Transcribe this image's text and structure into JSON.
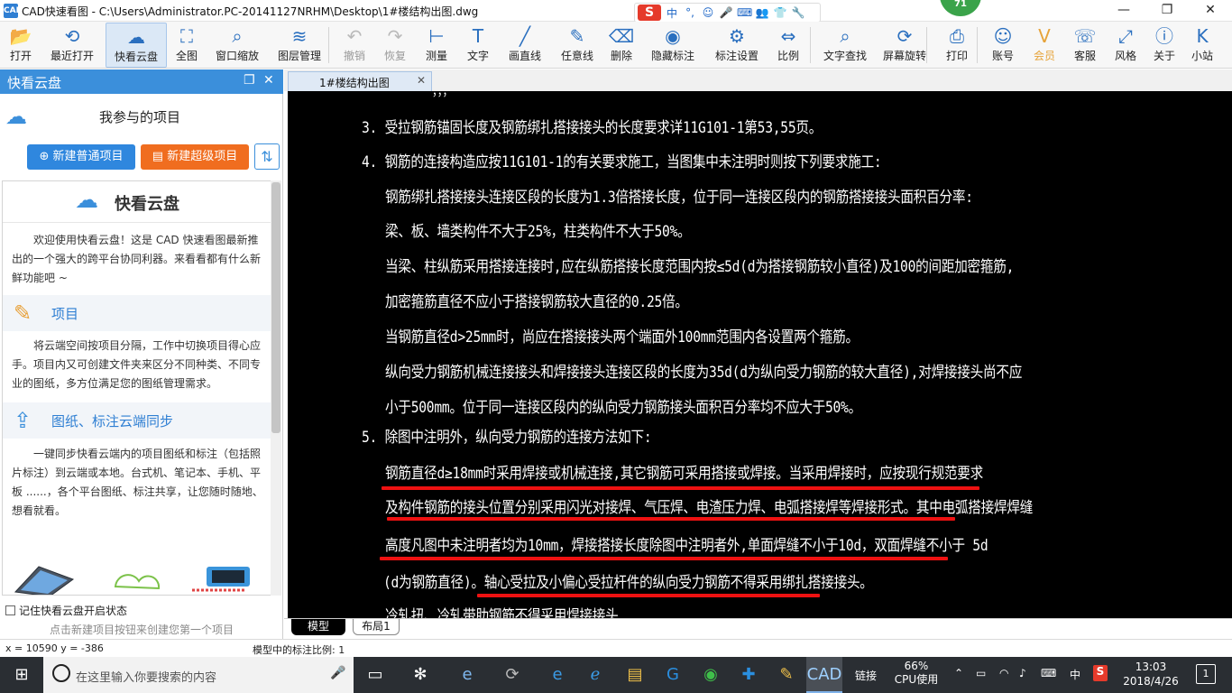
{
  "titlebar": {
    "title": "CAD快速看图 - C:\\Users\\Administrator.PC-20141127NRHM\\Desktop\\1#楼结构出图.dwg",
    "ime_symbols": [
      "中",
      "°,",
      "☺",
      "🎤",
      "⌨",
      "👥",
      "👕",
      "🔧"
    ],
    "badge": "71"
  },
  "toolbar": {
    "items": [
      {
        "label": "打开",
        "icon": "folder-open-icon",
        "glyph": "📂"
      },
      {
        "label": "最近打开",
        "icon": "recent-clock-icon",
        "glyph": "⟲"
      },
      {
        "label": "快看云盘",
        "icon": "cloud-icon",
        "glyph": "☁"
      },
      {
        "label": "全图",
        "icon": "fit-all-icon",
        "glyph": "⛶"
      },
      {
        "label": "窗口缩放",
        "icon": "zoom-window-icon",
        "glyph": "⌕"
      },
      {
        "label": "图层管理",
        "icon": "layers-icon",
        "glyph": "≋"
      },
      {
        "label": "撤销",
        "icon": "undo-icon",
        "glyph": "↶"
      },
      {
        "label": "恢复",
        "icon": "redo-icon",
        "glyph": "↷"
      },
      {
        "label": "测量",
        "icon": "measure-icon",
        "glyph": "⊢"
      },
      {
        "label": "文字",
        "icon": "text-icon",
        "glyph": "T"
      },
      {
        "label": "画直线",
        "icon": "line-icon",
        "glyph": "╱"
      },
      {
        "label": "任意线",
        "icon": "pen-icon",
        "glyph": "✎"
      },
      {
        "label": "删除",
        "icon": "eraser-icon",
        "glyph": "⌫"
      },
      {
        "label": "隐藏标注",
        "icon": "eye-hide-icon",
        "glyph": "◉"
      },
      {
        "label": "标注设置",
        "icon": "gear-icon",
        "glyph": "⚙"
      },
      {
        "label": "比例",
        "icon": "scale-icon",
        "glyph": "⇔"
      },
      {
        "label": "文字查找",
        "icon": "text-search-icon",
        "glyph": "⌕"
      },
      {
        "label": "屏幕旋转",
        "icon": "rotate-icon",
        "glyph": "⟳"
      },
      {
        "label": "打印",
        "icon": "printer-icon",
        "glyph": "⎙"
      },
      {
        "label": "账号",
        "icon": "user-icon",
        "glyph": "☺"
      },
      {
        "label": "会员",
        "icon": "vip-icon",
        "glyph": "V"
      },
      {
        "label": "客服",
        "icon": "headset-icon",
        "glyph": "☏"
      },
      {
        "label": "风格",
        "icon": "style-icon",
        "glyph": "⤢"
      },
      {
        "label": "关于",
        "icon": "info-icon",
        "glyph": "ⓘ"
      },
      {
        "label": "小站",
        "icon": "k-logo-icon",
        "glyph": "K"
      }
    ]
  },
  "left_panel": {
    "title": "快看云盘",
    "project_title": "我参与的项目",
    "new_normal": "新建普通项目",
    "new_super": "新建超级项目",
    "banner_title": "快看云盘",
    "intro": "欢迎使用快看云盘！这是 CAD 快速看图最新推出的一个强大的跨平台协同利器。来看看都有什么新鲜功能吧 ~",
    "section1_title": "项目",
    "section1_text": "将云端空间按项目分隔，工作中切换项目得心应手。项目内又可创建文件夹来区分不同种类、不同专业的图纸，多方位满足您的图纸管理需求。",
    "section2_title": "图纸、标注云端同步",
    "section2_text": "一键同步快看云端内的项目图纸和标注（包括照片标注）到云端或本地。台式机、笔记本、手机、平板 ......，各个平台图纸、标注共享，让您随时随地、想看就看。",
    "remember": "记住快看云盘开启状态",
    "hint": "点击新建项目按钮来创建您第一个项目"
  },
  "document_tab": {
    "name": "1#楼结构出图"
  },
  "drawing": {
    "lines": [
      "3. 受拉钢筋锚固长度及钢筋绑扎搭接接头的长度要求详11G101-1第53,55页。",
      "4. 钢筋的连接构造应按11G101-1的有关要求施工，当图集中未注明时则按下列要求施工:",
      "钢筋绑扎搭接接头连接区段的长度为1.3倍搭接长度，位于同一连接区段内的钢筋搭接接头面积百分率:",
      "梁、板、墙类构件不大于25%，柱类构件不大于50%。",
      "当梁、柱纵筋采用搭接连接时,应在纵筋搭接长度范围内按≤5d(d为搭接钢筋较小直径)及100的间距加密箍筋,",
      "加密箍筋直径不应小于搭接钢筋较大直径的0.25倍。",
      "当钢筋直径d>25mm时，尚应在搭接接头两个端面外100mm范围内各设置两个箍筋。",
      "纵向受力钢筋机械连接接头和焊接接头连接区段的长度为35d(d为纵向受力钢筋的较大直径),对焊接接头尚不应",
      "小于500mm。位于同一连接区段内的纵向受力钢筋接头面积百分率均不应大于50%。",
      "5. 除图中注明外，纵向受力钢筋的连接方法如下:",
      "钢筋直径d≥18mm时采用焊接或机械连接,其它钢筋可采用搭接或焊接。当采用焊接时，应按现行规范要求",
      "及构件钢筋的接头位置分别采用闪光对接焊、气压焊、电渣压力焊、电弧搭接焊等焊接形式。其中电弧搭接焊焊缝",
      "高度凡图中未注明者均为10mm，焊接搭接长度除图中注明者外,单面焊缝不小于10d，双面焊缝不小于 5d",
      "(d为钢筋直径)。轴心受拉及小偏心受拉杆件的纵向受力钢筋不得采用绑扎搭接接头。",
      "冷轧扭、冷轧带肋钢筋不得采用焊接接头"
    ]
  },
  "model_tabs": {
    "model": "模型",
    "layout": "布局1"
  },
  "status": {
    "coords": "x = 10590  y = -386",
    "scale": "模型中的标注比例: 1"
  },
  "taskbar": {
    "search_placeholder": "在这里输入你要搜索的内容",
    "link_label": "链接",
    "cpu_percent": "66%",
    "cpu_label": "CPU使用",
    "ime": "中",
    "time": "13:03",
    "date": "2018/4/26",
    "notif_count": "1"
  }
}
